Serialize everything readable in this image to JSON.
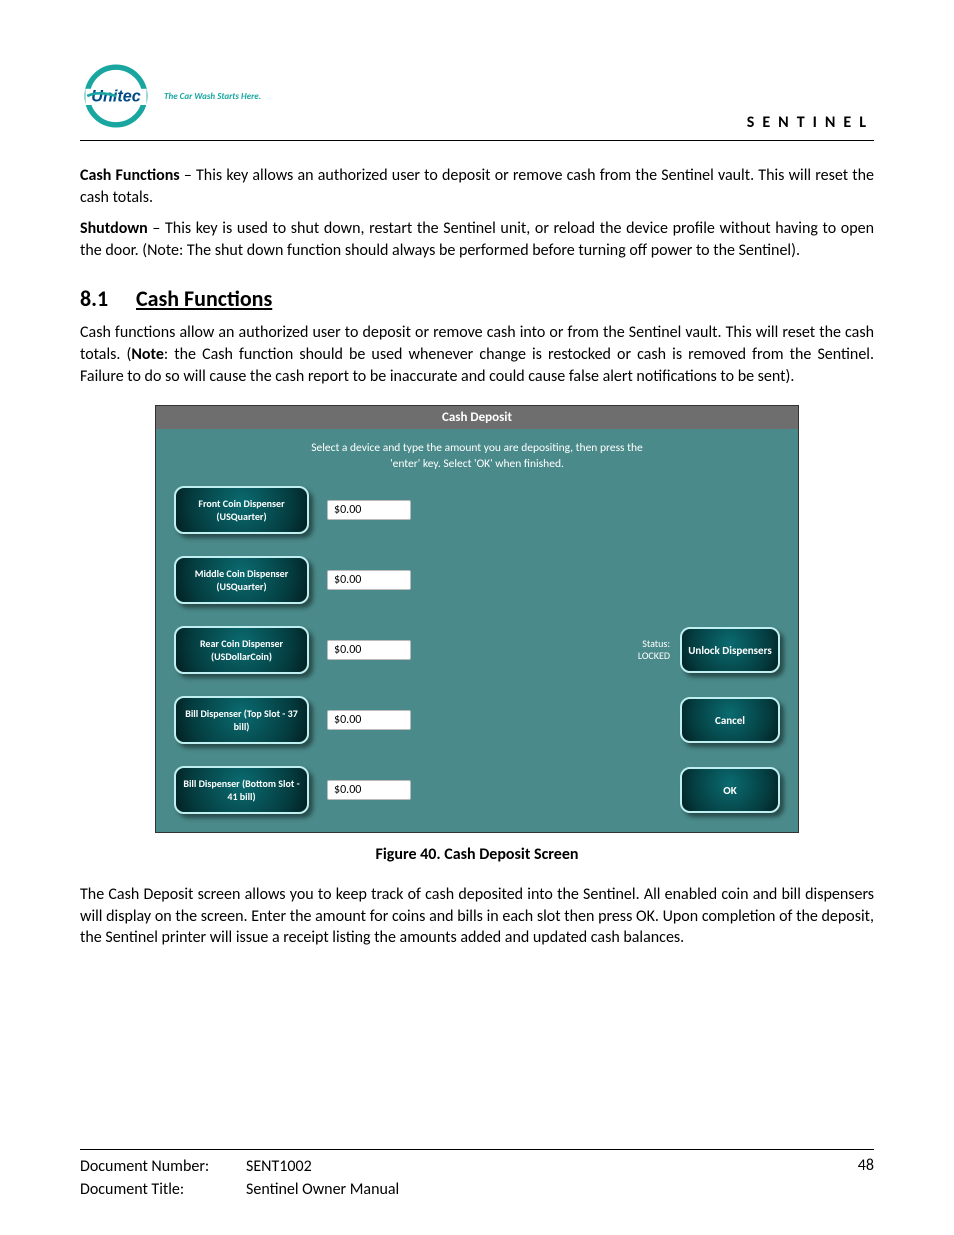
{
  "header": {
    "brand": "Unitec",
    "tagline": "The Car Wash Starts Here.",
    "product": "SENTINEL"
  },
  "paragraphs": {
    "p1_bold": "Cash Functions",
    "p1_rest": " – This key allows an authorized user to deposit or remove cash from the Sentinel vault. This will reset the cash totals.",
    "p2_bold": "Shutdown",
    "p2_rest": " – This key is used to shut down, restart the Sentinel unit, or reload the device profile without having to open the door. (Note: The shut down function should always be performed before turning off power to the Sentinel).",
    "section_num": "8.1",
    "section_title": "Cash Functions",
    "p3a": "Cash functions allow an authorized user to deposit or remove cash into or from the Sentinel vault. This will reset the cash totals. (",
    "p3_note": "Note",
    "p3b": ": the Cash function should be used whenever change is restocked or cash is removed from the Sentinel. Failure to do so will cause the cash report to be inaccurate and could cause false alert notifications to be sent).",
    "p4": "The Cash Deposit screen allows you to keep track of cash deposited into the Sentinel. All enabled coin and bill dispensers will display on the screen. Enter the amount for coins and bills in each slot then press OK. Upon completion of the deposit, the Sentinel printer will issue a receipt listing the amounts added and updated cash balances."
  },
  "figure": {
    "title": "Cash Deposit",
    "instruction": "Select a device and type the amount you are depositing, then press the 'enter' key.  Select 'OK' when finished.",
    "caption": "Figure 40. Cash Deposit Screen",
    "status_label": "Status:",
    "status_value": "LOCKED",
    "unlock_label": "Unlock Dispensers",
    "cancel_label": "Cancel",
    "ok_label": "OK",
    "dispensers": [
      {
        "label": "Front Coin Dispenser (USQuarter)",
        "amount": "$0.00"
      },
      {
        "label": "Middle Coin Dispenser (USQuarter)",
        "amount": "$0.00"
      },
      {
        "label": "Rear Coin Dispenser (USDollarCoin)",
        "amount": "$0.00"
      },
      {
        "label": "Bill Dispenser (Top Slot - 37 bill)",
        "amount": "$0.00"
      },
      {
        "label": "Bill Dispenser (Bottom Slot - 41 bill)",
        "amount": "$0.00"
      }
    ]
  },
  "footer": {
    "doc_number_label": "Document Number:",
    "doc_number": "SENT1002",
    "doc_title_label": "Document Title:",
    "doc_title": "Sentinel Owner Manual",
    "page_number": "48"
  }
}
